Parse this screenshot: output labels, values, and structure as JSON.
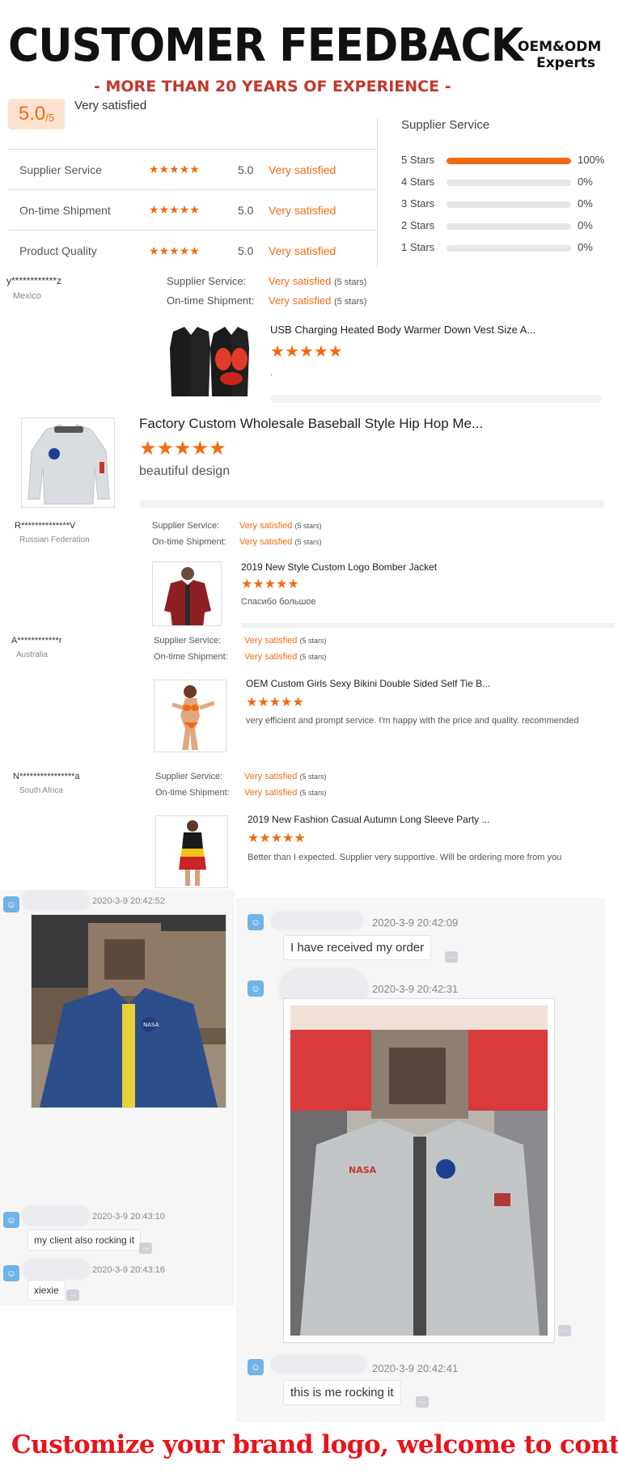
{
  "header": {
    "title": "CUSTOMER FEEDBACK",
    "oem_line1": "OEM&ODM",
    "oem_line2": "Experts",
    "subtitle": "- MORE THAN 20 YEARS OF EXPERIENCE -"
  },
  "overall": {
    "score": "5.0",
    "out_of": "/5",
    "label": "Very satisfied"
  },
  "ratings": [
    {
      "label": "Supplier Service",
      "value": "5.0",
      "text": "Very satisfied",
      "stars": 5
    },
    {
      "label": "On-time Shipment",
      "value": "5.0",
      "text": "Very satisfied",
      "stars": 5
    },
    {
      "label": "Product Quality",
      "value": "5.0",
      "text": "Very satisfied",
      "stars": 5
    }
  ],
  "supplier_service": {
    "title": "Supplier Service",
    "breakdown": [
      {
        "label": "5 Stars",
        "pct": "100%",
        "fraction": 1.0
      },
      {
        "label": "4 Stars",
        "pct": "0%",
        "fraction": 0
      },
      {
        "label": "3 Stars",
        "pct": "0%",
        "fraction": 0
      },
      {
        "label": "2 Stars",
        "pct": "0%",
        "fraction": 0
      },
      {
        "label": "1 Stars",
        "pct": "0%",
        "fraction": 0
      }
    ]
  },
  "labels": {
    "supplier_service": "Supplier Service:",
    "ontime_shipment": "On-time Shipment:",
    "very_satisfied": "Very satisfied",
    "five_stars": "(5 stars)"
  },
  "reviews": [
    {
      "name": "y************z",
      "country": "Mexico",
      "product": "USB Charging Heated Body Warmer Down Vest Size A...",
      "text": "."
    },
    {
      "name": "",
      "country": "",
      "product": "Factory Custom Wholesale Baseball Style Hip Hop Me...",
      "text": "beautiful design"
    },
    {
      "name": "R**************V",
      "country": "Russian Federation",
      "product": "2019 New Style Custom Logo Bomber Jacket",
      "text": "Спасибо большое"
    },
    {
      "name": "A************r",
      "country": "Australia",
      "product": "OEM Custom Girls Sexy Bikini Double Sided Self Tie B...",
      "text": "very efficient and prompt service. I'm happy with the price and quality. recommended"
    },
    {
      "name": "N****************a",
      "country": "South Africa",
      "product": "2019 New Fashion Casual Autumn Long Sleeve Party ...",
      "text": "Better than I expected. Supplier very supportive. Will be ordering more from you"
    }
  ],
  "chat": {
    "left": [
      {
        "time": "2020-3-9 20:42:52",
        "type": "image"
      },
      {
        "time": "2020-3-9 20:43:10",
        "text": "my client also rocking it"
      },
      {
        "time": "2020-3-9 20:43:16",
        "text": "xiexie"
      }
    ],
    "right": [
      {
        "time": "2020-3-9 20:42:09",
        "text": "I have received my order"
      },
      {
        "time": "2020-3-9 20:42:31",
        "type": "image"
      },
      {
        "time": "2020-3-9 20:42:41",
        "text": "this is me rocking it"
      }
    ],
    "jacket_logo": "NASA",
    "dots": "..."
  },
  "footer": "Customize your brand logo, welcome to contact us~",
  "colors": {
    "accent": "#f26b13",
    "footer_red": "#e8131b",
    "subtitle_red": "#c0392b",
    "chat_avatar": "#6fb3e8"
  }
}
